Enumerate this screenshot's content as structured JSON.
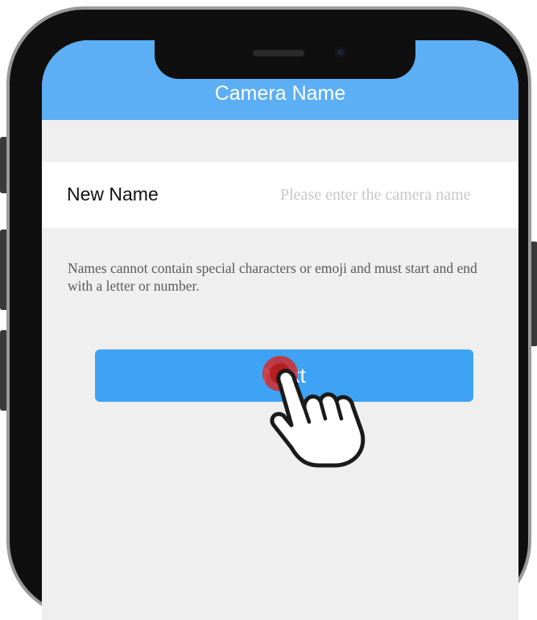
{
  "header": {
    "title": "Camera Name"
  },
  "form": {
    "label": "New Name",
    "placeholder": "Please enter the camera name",
    "value": ""
  },
  "hint": {
    "text": "Names cannot contain special characters or emoji and must start and end with a letter or number."
  },
  "actions": {
    "next_label": "Next"
  },
  "colors": {
    "header_bg": "#5caef5",
    "button_bg": "#3ea3f4",
    "screen_bg": "#efefef",
    "tap_indicator": "#d42a2a"
  },
  "icons": {
    "tap_cursor": "hand-pointer-icon"
  }
}
